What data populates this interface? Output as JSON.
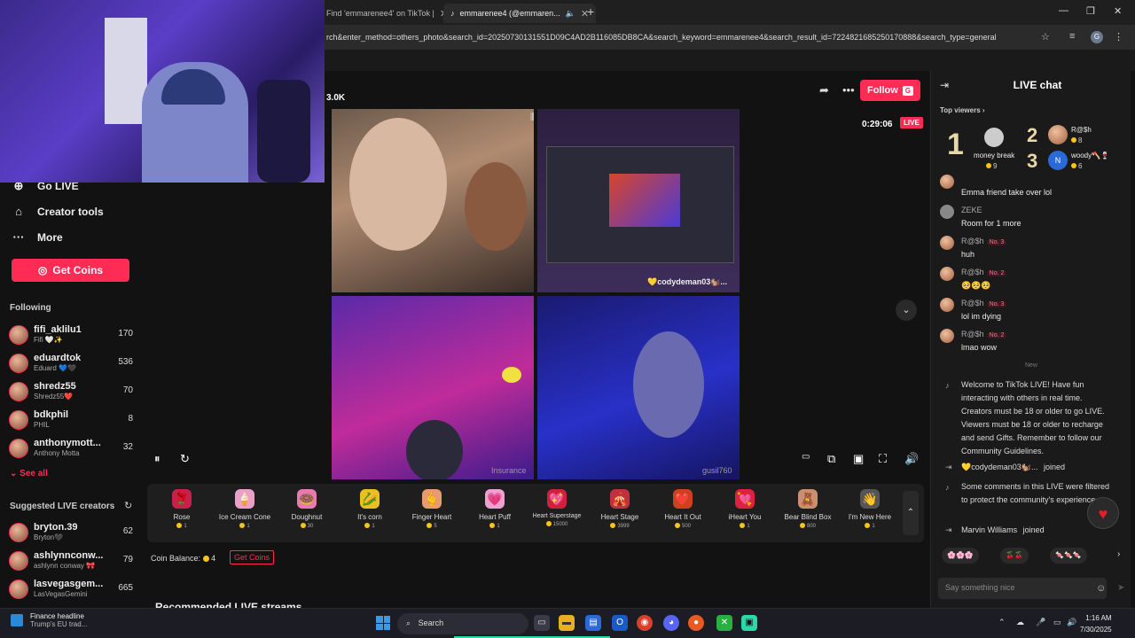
{
  "browser": {
    "tabs": [
      {
        "label": "Find 'emmarenee4' on TikTok |"
      },
      {
        "label": "emmarenee4 (@emmaren..."
      }
    ],
    "url": "rch&enter_method=others_photo&search_id=20250730131551D09C4AD2B116085DB8CA&search_keyword=emmarenee4&search_result_id=7224821685250170888&search_type=general",
    "profile_initial": "G"
  },
  "sidebar": {
    "nav": [
      {
        "label": "Go LIVE"
      },
      {
        "label": "Creator tools"
      },
      {
        "label": "More"
      }
    ],
    "get_coins": "Get Coins",
    "following_label": "Following",
    "following": [
      {
        "name": "fifi_aklilu1",
        "sub": "Fifi 🤍✨",
        "count": "170"
      },
      {
        "name": "eduardtok",
        "sub": "Eduard 💙🖤",
        "count": "536"
      },
      {
        "name": "shredz55",
        "sub": "Shredz55❤️",
        "count": "70"
      },
      {
        "name": "bdkphil",
        "sub": "PHIL",
        "count": "8"
      },
      {
        "name": "anthonymott...",
        "sub": "Anthony Motta",
        "count": "32"
      }
    ],
    "see_all": "See all",
    "suggested_label": "Suggested LIVE creators",
    "suggested": [
      {
        "name": "bryton.39",
        "sub": "Bryton🖤",
        "count": "62"
      },
      {
        "name": "ashlynnconw...",
        "sub": "ashlynn conway 🎀",
        "count": "79"
      },
      {
        "name": "lasvegasgem...",
        "sub": "LasVegasGemini",
        "count": "665"
      }
    ]
  },
  "stream": {
    "viewers": "3.0K",
    "follow_label": "Follow",
    "follow_badge": "G",
    "timer": "0:29:06",
    "live_badge": "LIVE",
    "cells": {
      "c2_label": "💛codydeman03🐿️...",
      "c3_label": "Insurance",
      "c4_label": "gusil760"
    }
  },
  "gifts": [
    {
      "name": "Rose",
      "price": "1",
      "icon": "🌹",
      "color": "#c8204a"
    },
    {
      "name": "Ice Cream Cone",
      "price": "1",
      "icon": "🍦",
      "color": "#e8a0c8"
    },
    {
      "name": "Doughnut",
      "price": "30",
      "icon": "🍩",
      "color": "#e87ab0"
    },
    {
      "name": "It's corn",
      "price": "1",
      "icon": "🌽",
      "color": "#e8c020"
    },
    {
      "name": "Finger Heart",
      "price": "5",
      "icon": "🫰",
      "color": "#e89a70"
    },
    {
      "name": "Heart Puff",
      "price": "1",
      "icon": "💗",
      "color": "#f0a0d0"
    },
    {
      "name": "Heart Superstage",
      "price": "15000",
      "icon": "💖",
      "color": "#d02040"
    },
    {
      "name": "Heart Stage",
      "price": "3999",
      "icon": "🎪",
      "color": "#c03040"
    },
    {
      "name": "Heart It Out",
      "price": "500",
      "icon": "❤️",
      "color": "#d04020"
    },
    {
      "name": "iHeart You",
      "price": "1",
      "icon": "💘",
      "color": "#e02040"
    },
    {
      "name": "Bear Blind Box",
      "price": "800",
      "icon": "🧸",
      "color": "#c89070"
    },
    {
      "name": "I'm New Here",
      "price": "1",
      "icon": "👋",
      "color": "#555555"
    }
  ],
  "coin_balance": {
    "label": "Coin Balance:",
    "value": "4",
    "button": "Get Coins"
  },
  "recommended_title": "Recommended LIVE streams",
  "chat": {
    "title": "LIVE chat",
    "top_viewers_label": "Top viewers",
    "top_viewers": [
      {
        "rank": "1",
        "name": "money break",
        "count": "9"
      },
      {
        "rank": "2",
        "name": "R@$h",
        "count": "8"
      },
      {
        "rank": "3",
        "name": "woody🪓🍷",
        "count": "6"
      }
    ],
    "messages": [
      {
        "name": "",
        "badge": "",
        "text": "Emma friend take over lol"
      },
      {
        "name": "ZEKE",
        "badge": "",
        "text": "Room for 1 more"
      },
      {
        "name": "R@$h",
        "badge": "No. 3",
        "text": "huh"
      },
      {
        "name": "R@$h",
        "badge": "No. 2",
        "text": "🥺🥺🥺"
      },
      {
        "name": "R@$h",
        "badge": "No. 3",
        "text": "lol im dying"
      },
      {
        "name": "R@$h",
        "badge": "No. 2",
        "text": "lmao wow"
      }
    ],
    "new_divider": "New",
    "welcome": "Welcome to TikTok LIVE! Have fun interacting with others in real time. Creators must be 18 or older to go LIVE. Viewers must be 18 or older to recharge and send Gifts. Remember to follow our Community Guidelines.",
    "join1_name": "💛codydeman03🐿️...",
    "join1_action": "joined",
    "filtered": "Some comments in this LIVE were filtered to protect the community's experience.",
    "join2_name": "Marvin Williams",
    "join2_action": "joined",
    "emotes": [
      "🌸🌸🌸",
      "🍒🍒",
      "🍬🍬🍬"
    ],
    "input_placeholder": "Say something nice"
  },
  "taskbar": {
    "news_title": "Finance headline",
    "news_sub": "Trump's EU trad...",
    "search": "Search",
    "time": "1:16 AM",
    "date": "7/30/2025"
  }
}
